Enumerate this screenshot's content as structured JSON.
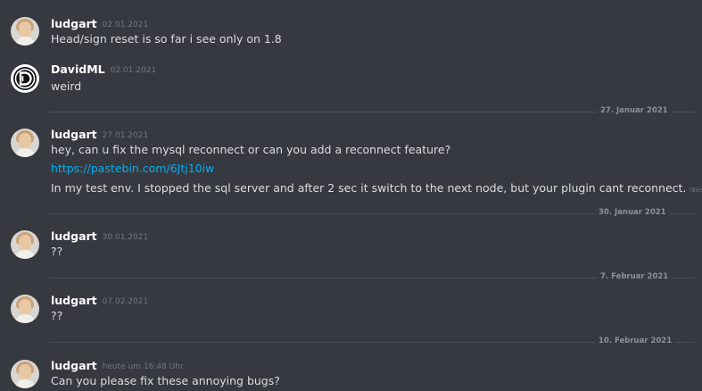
{
  "messages": [
    {
      "author": "ludgart",
      "timestamp": "02.01.2021",
      "lines": [
        "Head/sign reset is so far i see only on 1.8"
      ]
    },
    {
      "author": "DavidML",
      "timestamp": "02.01.2021",
      "lines": [
        "weird"
      ]
    },
    {
      "author": "ludgart",
      "timestamp": "27.01.2021",
      "lines": [
        "hey, can u fix the mysql reconnect or can you add a reconnect feature?",
        "https://pastebin.com/6Jtj10iw",
        "In my test env. I stopped the sql server and after 2 sec it switch to the next node, but your plugin cant reconnect."
      ],
      "edited_label": "(Bearbeitet)"
    },
    {
      "author": "ludgart",
      "timestamp": "30.01.2021",
      "lines": [
        "??"
      ]
    },
    {
      "author": "ludgart",
      "timestamp": "07.02.2021",
      "lines": [
        "??"
      ]
    },
    {
      "author": "ludgart",
      "timestamp": "heute um 16:48 Uhr",
      "lines": [
        "Can you please fix these annoying bugs?"
      ]
    }
  ],
  "dividers": [
    "27. Januar 2021",
    "30. Januar 2021",
    "7. Februar 2021",
    "10. Februar 2021"
  ],
  "colors": {
    "background": "#36393f",
    "author": "#ffffff",
    "text": "#dcddde",
    "link": "#00aff4",
    "muted": "#72767d",
    "divider_line": "#4a4d53"
  },
  "icons": {
    "ludgart_avatar": "user-photo-avatar",
    "davidml_avatar": "d-logo-avatar"
  }
}
